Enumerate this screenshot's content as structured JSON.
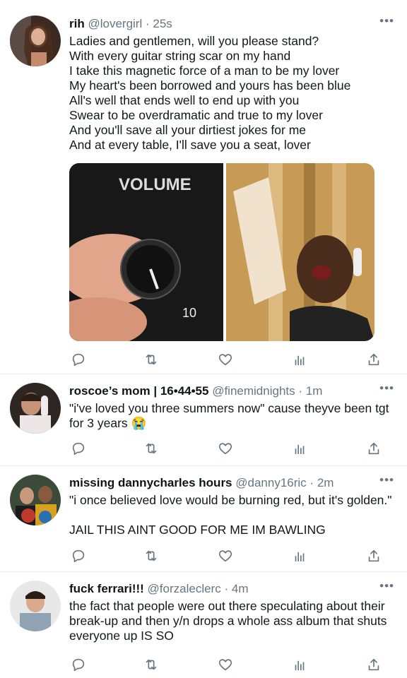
{
  "tweets": [
    {
      "name": "rih",
      "handle": "@lovergirl",
      "time": "25s",
      "text": "Ladies and gentlemen, will you please stand?\nWith every guitar string scar on my hand\nI take this magnetic force of a man to be my lover\nMy heart's been borrowed and yours has been blue\nAll's well that ends well to end up with you\nSwear to be overdramatic and true to my lover\nAnd you'll save all your dirtiest jokes for me\nAnd at every table, I'll save you a seat, lover",
      "media_text": [
        "VOLUME",
        "10"
      ]
    },
    {
      "name": "roscoe’s mom | 16•44•55",
      "handle": "@finemidnights",
      "time": "1m",
      "text": "\"i've loved you three summers now\" cause theyve been tgt for 3 years 😭"
    },
    {
      "name": "missing dannycharles hours",
      "handle": "@danny16ric",
      "time": "2m",
      "text": "\"i once believed love would be burning red, but it's golden.\"\n\nJAIL THIS AINT GOOD FOR ME IM BAWLING"
    },
    {
      "name": "fuck ferrari!!!",
      "handle": "@forzaleclerc",
      "time": "4m",
      "text": "the fact that people were out there speculating about their break-up and then y/n drops a whole ass album that shuts everyone up IS SO"
    }
  ],
  "ui": {
    "dot": "·",
    "more": "•••"
  },
  "icons": [
    "reply-icon",
    "retweet-icon",
    "like-icon",
    "analytics-icon",
    "share-icon"
  ],
  "colors": {
    "icon": "#66757f",
    "divider": "#e6ecf0"
  }
}
